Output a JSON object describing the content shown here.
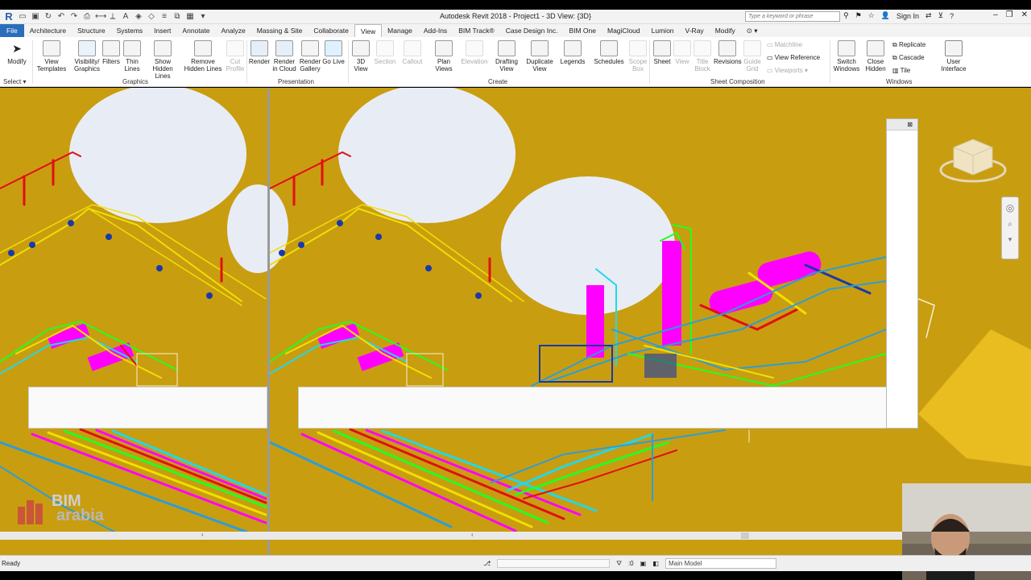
{
  "title_bar": {
    "title": "Autodesk Revit 2018 -    Project1 - 3D View: {3D}",
    "search_placeholder": "Type a keyword or phrase",
    "sign_in": "Sign In"
  },
  "tabs": [
    "File",
    "Architecture",
    "Structure",
    "Systems",
    "Insert",
    "Annotate",
    "Analyze",
    "Massing & Site",
    "Collaborate",
    "View",
    "Manage",
    "Add-Ins",
    "BIM Track®",
    "Case Design Inc.",
    "BIM One",
    "MagiCloud",
    "Lumion",
    "V-Ray",
    "Modify"
  ],
  "active_tab": "View",
  "ribbon": {
    "modify": "Modify",
    "select": "Select",
    "graphics_buttons": [
      {
        "label": "View\nTemplates"
      },
      {
        "label": "Visibility/\nGraphics"
      },
      {
        "label": "Filters"
      },
      {
        "label": "Thin\nLines"
      },
      {
        "label": "Show\nHidden Lines"
      },
      {
        "label": "Remove\nHidden Lines"
      },
      {
        "label": "Cut\nProfile"
      }
    ],
    "graphics_label": "Graphics",
    "presentation_buttons": [
      {
        "label": "Render"
      },
      {
        "label": "Render\nin Cloud"
      },
      {
        "label": "Render\nGallery"
      },
      {
        "label": "Go Live"
      }
    ],
    "presentation_label": "Presentation",
    "create_buttons": [
      {
        "label": "3D\nView"
      },
      {
        "label": "Section"
      },
      {
        "label": "Callout"
      },
      {
        "label": "Plan\nViews"
      },
      {
        "label": "Elevation"
      },
      {
        "label": "Drafting\nView"
      },
      {
        "label": "Duplicate\nView"
      },
      {
        "label": "Legends"
      },
      {
        "label": "Schedules"
      },
      {
        "label": "Scope\nBox"
      }
    ],
    "create_label": "Create",
    "sheet_buttons": [
      {
        "label": "Sheet"
      },
      {
        "label": "View"
      },
      {
        "label": "Title\nBlock"
      },
      {
        "label": "Revisions"
      },
      {
        "label": "Guide\nGrid"
      }
    ],
    "sheet_small": [
      "Matchline",
      "View Reference",
      "Viewports"
    ],
    "sheet_label": "Sheet Composition",
    "windows_buttons": [
      {
        "label": "Switch\nWindows"
      },
      {
        "label": "Close\nHidden"
      }
    ],
    "windows_small": [
      "Replicate",
      "Cascade",
      "Tile"
    ],
    "user_interface": "User\nInterface",
    "windows_label": "Windows"
  },
  "status": {
    "ready": "Ready",
    "model": "Main Model",
    "count": ":0"
  },
  "brand": {
    "line1": "BIM",
    "line2": "arabia"
  },
  "colors": {
    "background": "#c99d10",
    "pipe_yellow": "#f0e000",
    "pipe_magenta": "#ff00ff",
    "pipe_green": "#22ff22",
    "pipe_cyan": "#22d8e8",
    "steel_blue": "#2a9fd8",
    "valve_red": "#e01010",
    "file_tab": "#2a6ebb"
  }
}
